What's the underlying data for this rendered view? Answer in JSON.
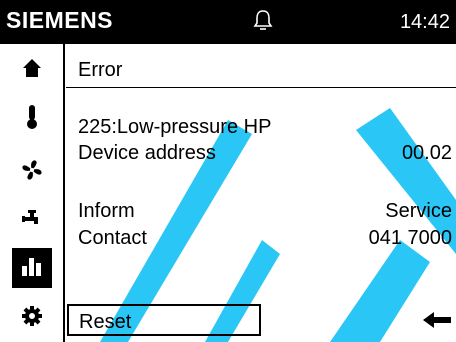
{
  "header": {
    "brand": "SIEMENS",
    "time": "14:42"
  },
  "sidebar": {
    "items": [
      {
        "icon": "home-icon"
      },
      {
        "icon": "thermometer-icon"
      },
      {
        "icon": "fan-icon"
      },
      {
        "icon": "faucet-icon"
      },
      {
        "icon": "bar-chart-icon",
        "active": true
      },
      {
        "icon": "gear-icon"
      }
    ]
  },
  "content": {
    "title": "Error",
    "error_code": "225:Low-pressure HP",
    "device_address_label": "Device address",
    "device_address_value": "00.02",
    "inform_label": "Inform",
    "inform_value": "Service",
    "contact_label": "Contact",
    "contact_value": "041 7000",
    "reset_label": "Reset"
  },
  "colors": {
    "bar": "#000000",
    "watermark": "#00BFFF",
    "background": "#FFFFFF"
  }
}
